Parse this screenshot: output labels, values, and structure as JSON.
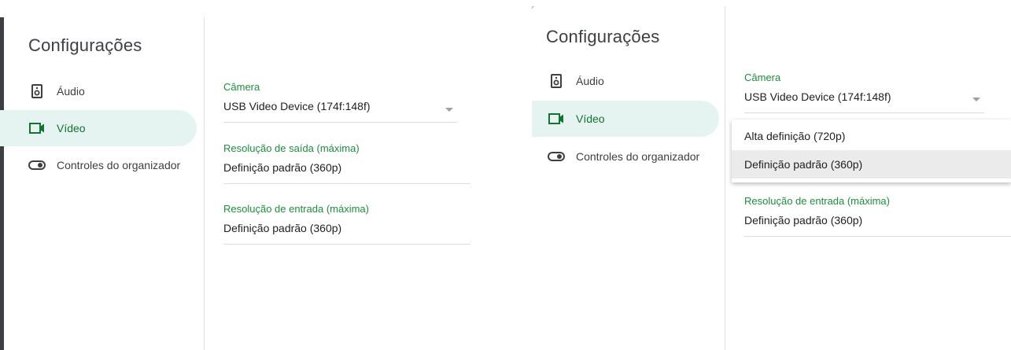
{
  "panel1": {
    "title": "Configurações",
    "nav": [
      {
        "label": "Áudio",
        "icon": "speaker-icon"
      },
      {
        "label": "Vídeo",
        "icon": "videocam-icon",
        "active": true
      },
      {
        "label": "Controles do organizador",
        "icon": "toggle-icon"
      }
    ],
    "fields": [
      {
        "label": "Câmera",
        "value": "USB Video Device (174f:148f)",
        "dropdown": true
      },
      {
        "label": "Resolução de saída (máxima)",
        "value": "Definição padrão (360p)"
      },
      {
        "label": "Resolução de entrada (máxima)",
        "value": "Definição padrão (360p)"
      }
    ]
  },
  "panel2": {
    "title": "Configurações",
    "nav": [
      {
        "label": "Áudio",
        "icon": "speaker-icon"
      },
      {
        "label": "Vídeo",
        "icon": "videocam-icon",
        "active": true
      },
      {
        "label": "Controles do organizador",
        "icon": "toggle-icon"
      }
    ],
    "fields": [
      {
        "label": "Câmera",
        "value": "USB Video Device (174f:148f)",
        "dropdown": true
      },
      {
        "label": "Resolução de entrada (máxima)",
        "value": "Definição padrão (360p)"
      }
    ],
    "dropdown_options": [
      {
        "label": "Alta definição (720p)",
        "selected": false
      },
      {
        "label": "Definição padrão (360p)",
        "selected": true
      }
    ]
  },
  "colors": {
    "accent": "#1e8e3e",
    "active_bg": "#e6f4f1",
    "divider": "#dadce0"
  }
}
